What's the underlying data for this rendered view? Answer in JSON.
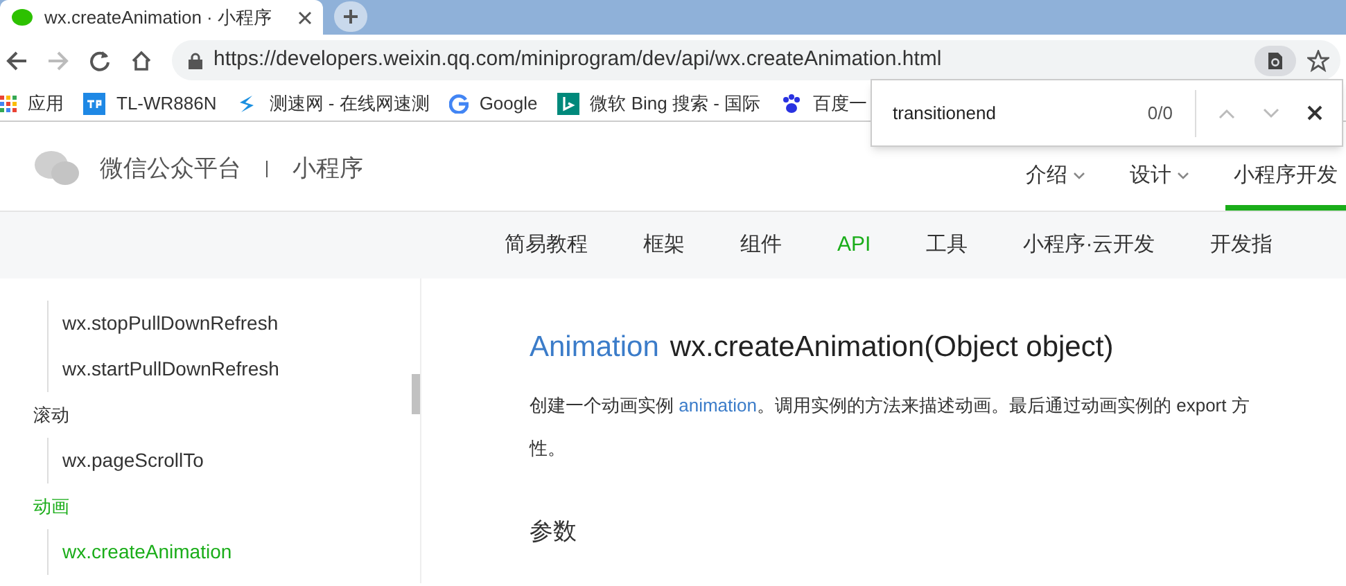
{
  "browser": {
    "tabs": [
      {
        "title": "wx.createAnimation · 小程序",
        "selected": true
      }
    ],
    "url": "https://developers.weixin.qq.com/miniprogram/dev/api/wx.createAnimation.html",
    "bookmarks": [
      {
        "label": "应用",
        "kind": "apps"
      },
      {
        "label": "TL-WR886N",
        "kind": "tp"
      },
      {
        "label": "测速网 - 在线网速测",
        "kind": "speed"
      },
      {
        "label": "Google",
        "kind": "google"
      },
      {
        "label": "微软 Bing 搜索 - 国际",
        "kind": "bing"
      },
      {
        "label": "百度一",
        "kind": "baidu"
      }
    ],
    "find_bar": {
      "value": "transitionend",
      "count": "0/0"
    }
  },
  "site": {
    "brand": "微信公众平台",
    "section": "小程序",
    "nav": [
      {
        "label": "介绍",
        "dropdown": true,
        "selected": false
      },
      {
        "label": "设计",
        "dropdown": true,
        "selected": false
      },
      {
        "label": "小程序开发",
        "dropdown": false,
        "selected": true
      }
    ],
    "subnav": [
      {
        "label": "简易教程",
        "selected": false
      },
      {
        "label": "框架",
        "selected": false
      },
      {
        "label": "组件",
        "selected": false
      },
      {
        "label": "API",
        "selected": true
      },
      {
        "label": "工具",
        "selected": false
      },
      {
        "label": "小程序·云开发",
        "selected": false
      },
      {
        "label": "开发指",
        "selected": false
      }
    ]
  },
  "sidebar": {
    "items": [
      {
        "label": "wx.stopPullDownRefresh",
        "kind": "child",
        "selected": false
      },
      {
        "label": "wx.startPullDownRefresh",
        "kind": "child",
        "selected": false
      },
      {
        "label": "滚动",
        "kind": "group",
        "selected": false
      },
      {
        "label": "wx.pageScrollTo",
        "kind": "child",
        "selected": false
      },
      {
        "label": "动画",
        "kind": "group",
        "selected": true
      },
      {
        "label": "wx.createAnimation",
        "kind": "child",
        "selected": true
      }
    ]
  },
  "content": {
    "title_link": "Animation",
    "title": "wx.createAnimation(Object object)",
    "description": {
      "before": "创建一个动画实例 ",
      "link": "animation",
      "after": "。调用实例的方法来描述动画。最后通过动画实例的 export 方",
      "line2": "性。"
    },
    "heading": "参数"
  }
}
